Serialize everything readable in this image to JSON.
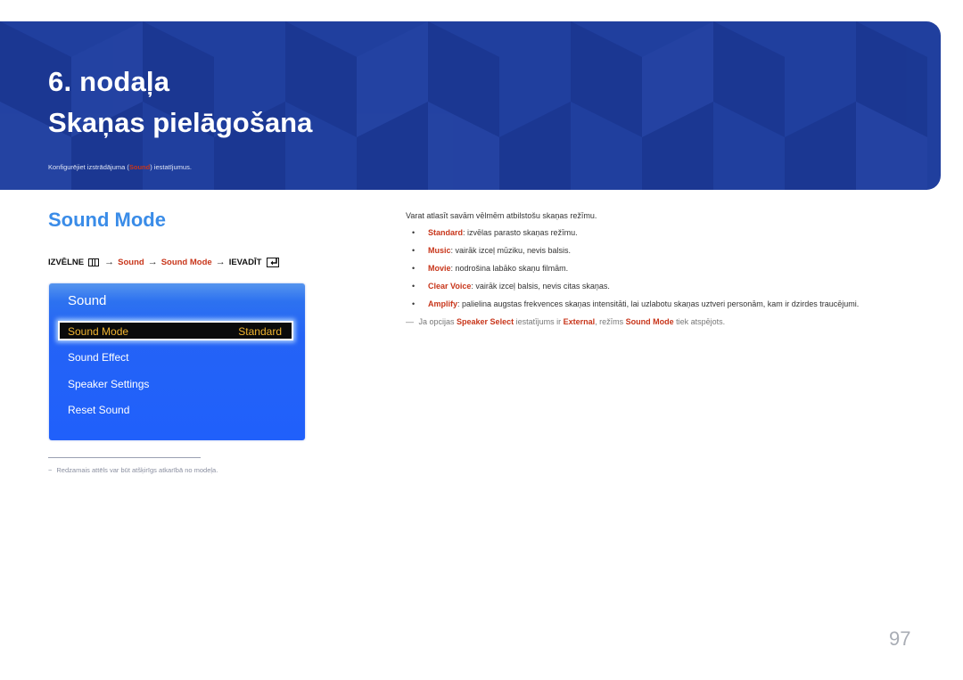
{
  "banner": {
    "chapter_number": "6. nodaļa",
    "chapter_title": "Skaņas pielāgošana",
    "description_before": "Konfigurējiet izstrādājuma (",
    "description_highlight": "Sound",
    "description_after": ") iestatījumus."
  },
  "section": {
    "title": "Sound Mode",
    "menu_path": {
      "menu_label": "IZVĒLNE",
      "menu_icon": "menu-bars-icon",
      "arrow": "→",
      "step1": "Sound",
      "step2": "Sound Mode",
      "enter_label": "IEVADĪT",
      "enter_icon": "enter-icon"
    }
  },
  "osd": {
    "title": "Sound",
    "selected_item": {
      "label": "Sound Mode",
      "value": "Standard"
    },
    "items": [
      "Sound Effect",
      "Speaker Settings",
      "Reset Sound"
    ]
  },
  "footnote": {
    "dash": "−",
    "text": "Redzamais attēls var būt atšķirīgs atkarībā no modeļa."
  },
  "content": {
    "intro": "Varat atlasīt savām vēlmēm atbilstošu skaņas režīmu.",
    "bullet_char": "•",
    "options": [
      {
        "name": "Standard",
        "desc": ": izvēlas parasto skaņas režīmu."
      },
      {
        "name": "Music",
        "desc": ": vairāk izceļ mūziku, nevis balsis."
      },
      {
        "name": "Movie",
        "desc": ": nodrošina labāko skaņu filmām."
      },
      {
        "name": "Clear Voice",
        "desc": ": vairāk izceļ balsis, nevis citas skaņas."
      },
      {
        "name": "Amplify",
        "desc": ": palielina augstas frekvences skaņas intensitāti, lai uzlabotu skaņas uztveri personām, kam ir dzirdes traucējumi."
      }
    ],
    "note": {
      "dash": "—",
      "t1": " Ja opcijas ",
      "h1": "Speaker Select",
      "t2": " iestatījums ir ",
      "h2": "External",
      "t3": ", režīms ",
      "h3": "Sound Mode",
      "t4": " tiek atspējots."
    }
  },
  "page_number": "97",
  "colors": {
    "banner_bg": "#203f9e",
    "section_title": "#3a8ce8",
    "highlight_red": "#c8361b",
    "osd_blue": "#2463f6",
    "osd_selected_text": "#f0b531"
  }
}
